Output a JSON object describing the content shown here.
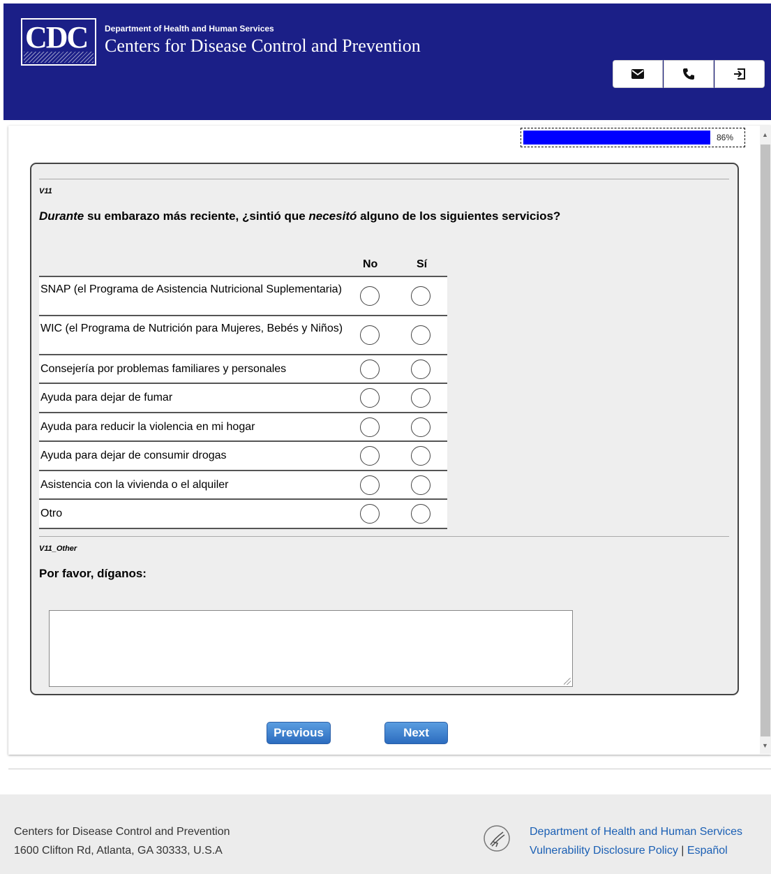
{
  "header": {
    "logo_text": "CDC",
    "department": "Department of Health and Human Services",
    "agency": "Centers for Disease Control and Prevention",
    "icons": [
      "envelope-icon",
      "phone-icon",
      "exit-icon"
    ]
  },
  "progress": {
    "value": 0.86,
    "label": "86%"
  },
  "question": {
    "id": "V11",
    "text_em1": "Durante",
    "text_mid": " su embarazo más reciente, ¿sintió que ",
    "text_em2": "necesitó",
    "text_end": " alguno de los siguientes servicios?",
    "columns": [
      "No",
      "Sí"
    ],
    "rows": [
      "SNAP (el Programa de Asistencia Nutricional Suplementaria)",
      "WIC (el Programa de Nutrición para Mujeres, Bebés y Niños)",
      "Consejería por problemas familiares y personales",
      "Ayuda para dejar de fumar",
      "Ayuda para reducir la violencia en mi hogar",
      "Ayuda para dejar de consumir drogas",
      "Asistencia con la vivienda o el alquiler",
      "Otro"
    ]
  },
  "other": {
    "id": "V11_Other",
    "prompt": "Por favor, díganos:",
    "value": ""
  },
  "nav": {
    "previous": "Previous",
    "next": "Next"
  },
  "footer": {
    "org": "Centers for Disease Control and Prevention",
    "address": "1600 Clifton Rd, Atlanta, GA 30333, U.S.A",
    "hhs_link": "Department of Health and Human Services",
    "vdp_link": "Vulnerability Disclosure Policy",
    "separator": "|",
    "espanol_link": "Español"
  },
  "colors": {
    "header_bg": "#1b1f87",
    "progress_fill": "#0000ff",
    "button": "#2c6cbf",
    "link": "#1a5fb4"
  }
}
